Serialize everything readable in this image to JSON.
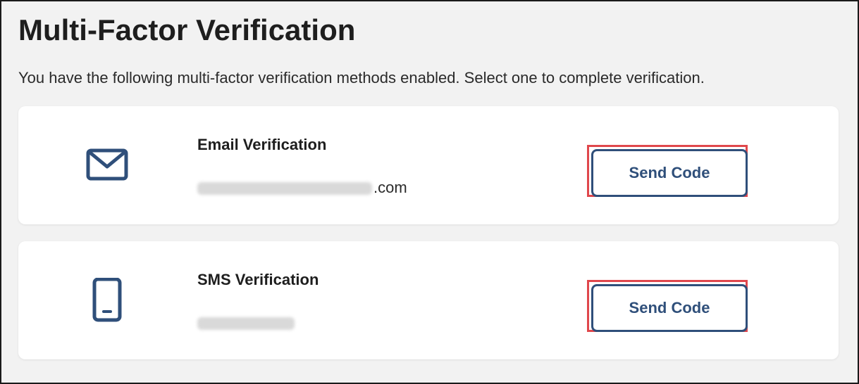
{
  "page": {
    "title": "Multi-Factor Verification",
    "intro": "You have the following multi-factor verification methods enabled. Select one to complete verification."
  },
  "methods": [
    {
      "title": "Email Verification",
      "detail_visible": ".com",
      "icon": "envelope-icon",
      "button_label": "Send Code"
    },
    {
      "title": "SMS Verification",
      "detail_visible": "",
      "icon": "mobile-phone-icon",
      "button_label": "Send Code"
    }
  ],
  "colors": {
    "accent": "#2f4f7a",
    "highlight": "#e0474c",
    "background": "#f2f2f2",
    "card": "#ffffff"
  }
}
